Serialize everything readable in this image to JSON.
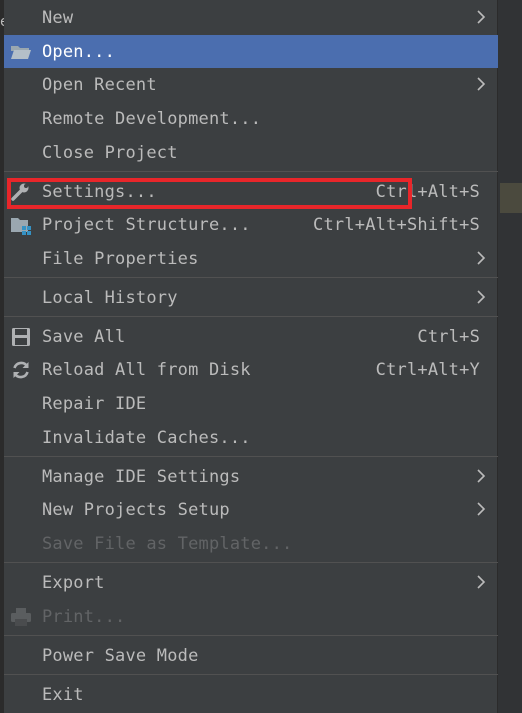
{
  "menu": {
    "items": [
      {
        "label": "New",
        "shortcut": "",
        "submenu": true,
        "icon": ""
      },
      {
        "label": "Open...",
        "shortcut": "",
        "submenu": false,
        "icon": "folder-open-icon",
        "highlighted": true
      },
      {
        "label": "Open Recent",
        "shortcut": "",
        "submenu": true,
        "icon": ""
      },
      {
        "label": "Remote Development...",
        "shortcut": "",
        "submenu": false,
        "icon": ""
      },
      {
        "label": "Close Project",
        "shortcut": "",
        "submenu": false,
        "icon": ""
      },
      {
        "label": "Settings...",
        "shortcut": "Ctrl+Alt+S",
        "submenu": false,
        "icon": "wrench-icon"
      },
      {
        "label": "Project Structure...",
        "shortcut": "Ctrl+Alt+Shift+S",
        "submenu": false,
        "icon": "project-structure-icon"
      },
      {
        "label": "File Properties",
        "shortcut": "",
        "submenu": true,
        "icon": ""
      },
      {
        "label": "Local History",
        "shortcut": "",
        "submenu": true,
        "icon": ""
      },
      {
        "label": "Save All",
        "shortcut": "Ctrl+S",
        "submenu": false,
        "icon": "save-icon"
      },
      {
        "label": "Reload All from Disk",
        "shortcut": "Ctrl+Alt+Y",
        "submenu": false,
        "icon": "reload-icon"
      },
      {
        "label": "Repair IDE",
        "shortcut": "",
        "submenu": false,
        "icon": ""
      },
      {
        "label": "Invalidate Caches...",
        "shortcut": "",
        "submenu": false,
        "icon": ""
      },
      {
        "label": "Manage IDE Settings",
        "shortcut": "",
        "submenu": true,
        "icon": ""
      },
      {
        "label": "New Projects Setup",
        "shortcut": "",
        "submenu": true,
        "icon": ""
      },
      {
        "label": "Save File as Template...",
        "shortcut": "",
        "submenu": false,
        "icon": "",
        "disabled": true
      },
      {
        "label": "Export",
        "shortcut": "",
        "submenu": true,
        "icon": ""
      },
      {
        "label": "Print...",
        "shortcut": "",
        "submenu": false,
        "icon": "print-icon",
        "disabled": true
      },
      {
        "label": "Power Save Mode",
        "shortcut": "",
        "submenu": false,
        "icon": ""
      },
      {
        "label": "Exit",
        "shortcut": "",
        "submenu": false,
        "icon": ""
      }
    ]
  },
  "colors": {
    "menu_bg": "#3c3f41",
    "highlight": "#4b6eaf",
    "text": "#bbbbbb",
    "disabled_text": "#626466",
    "callout": "#e8262a"
  }
}
